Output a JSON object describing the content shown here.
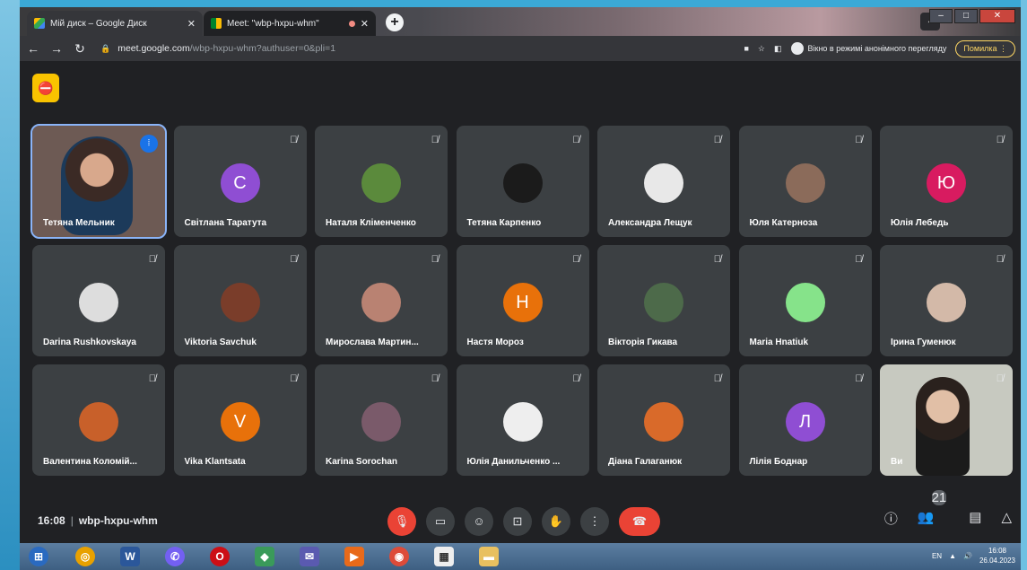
{
  "browser": {
    "tabs": [
      {
        "title": "Мій диск – Google Диск",
        "close": "✕"
      },
      {
        "title": "Meet: \"wbp-hxpu-whm\"",
        "close": "✕"
      }
    ],
    "new_tab": "+",
    "url_host": "meet.google.com",
    "url_path": "/wbp-hxpu-whm?authuser=0&pli=1",
    "incognito_label": "Вікно в режимі анонімного перегляду",
    "error_button": "Помилка ⋮"
  },
  "participants": [
    {
      "name": "Тетяна Мельник",
      "type": "video",
      "speaking": true
    },
    {
      "name": "Світлана Таратута",
      "initial": "С",
      "color": "#8f4ed3"
    },
    {
      "name": "Наталя Кліменченко",
      "color": "#5b8a3c"
    },
    {
      "name": "Тетяна Карпенко",
      "color": "#1b1b1b"
    },
    {
      "name": "Александра Лещук",
      "color": "#e8e8e8"
    },
    {
      "name": "Юля Катерноза",
      "color": "#8b6b5a"
    },
    {
      "name": "Юлія Лебедь",
      "initial": "Ю",
      "color": "#d81b60"
    },
    {
      "name": "Darina Rushkovskaya",
      "color": "#ddd"
    },
    {
      "name": "Viktoria Savchuk",
      "color": "#7a3d2a"
    },
    {
      "name": "Мирослава Мартин...",
      "color": "#b98272"
    },
    {
      "name": "Настя Мороз",
      "initial": "Н",
      "color": "#e8710a"
    },
    {
      "name": "Вікторія Гикава",
      "color": "#4d6a4a"
    },
    {
      "name": "Maria Hnatiuk",
      "color": "#86e38a"
    },
    {
      "name": "Ірина Гуменюк",
      "color": "#d3b9a8"
    },
    {
      "name": "Валентина Коломій...",
      "color": "#c8602a"
    },
    {
      "name": "Vika Klantsata",
      "initial": "V",
      "color": "#e8710a"
    },
    {
      "name": "Karina Sorochan",
      "color": "#7a5a6a"
    },
    {
      "name": "Юлія Данильченко ...",
      "color": "#eee"
    },
    {
      "name": "Діана Галаганюк",
      "color": "#d96a2a"
    },
    {
      "name": "Лілія Боднар",
      "initial": "Л",
      "color": "#8f4ed3"
    },
    {
      "name": "Ви",
      "type": "self"
    }
  ],
  "meeting": {
    "time": "16:08",
    "code": "wbp-hxpu-whm",
    "participant_count": "21"
  },
  "taskbar": {
    "lang": "EN",
    "time": "16:08",
    "date": "26.04.2023"
  }
}
